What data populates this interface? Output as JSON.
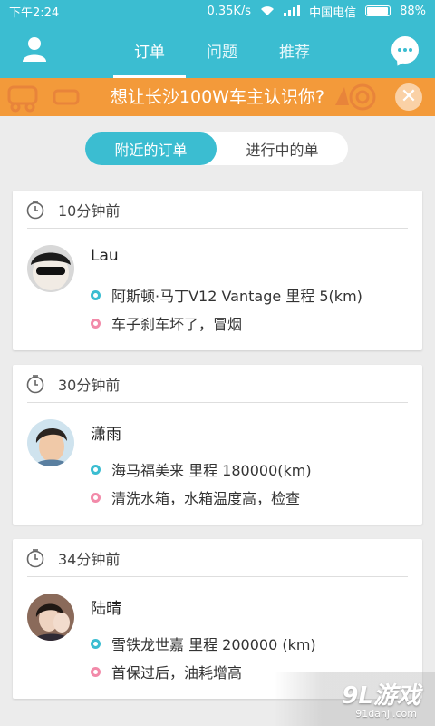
{
  "status_bar": {
    "time": "下午2:24",
    "speed": "0.35K/s",
    "carrier": "中国电信",
    "battery": "88%"
  },
  "header": {
    "tabs": [
      {
        "label": "订单",
        "active": true
      },
      {
        "label": "问题",
        "active": false
      },
      {
        "label": "推荐",
        "active": false
      }
    ],
    "user_icon": "user-icon",
    "chat_icon": "chat-bubble-icon"
  },
  "banner": {
    "text": "想让长沙100W车主认识你?",
    "close_symbol": "✕"
  },
  "segment": {
    "options": [
      {
        "label": "附近的订单",
        "active": true
      },
      {
        "label": "进行中的单",
        "active": false
      }
    ]
  },
  "orders": [
    {
      "time": "10分钟前",
      "name": "Lau",
      "car": "阿斯顿·马丁V12 Vantage  里程 5(km)",
      "issue": "车子刹车坏了，冒烟"
    },
    {
      "time": "30分钟前",
      "name": "潇雨",
      "car": "海马福美来  里程 180000(km)",
      "issue": "清洗水箱，水箱温度高，检查"
    },
    {
      "time": "34分钟前",
      "name": "陆晴",
      "car": "雪铁龙世嘉 里程 200000 (km)",
      "issue": "首保过后，油耗增高"
    }
  ],
  "watermark": {
    "logo": "9L游戏",
    "url": "91danji.com"
  },
  "colors": {
    "primary": "#3bbdd1",
    "banner": "#f39a3a",
    "accent_pink": "#f28aa9",
    "background": "#ececec"
  }
}
